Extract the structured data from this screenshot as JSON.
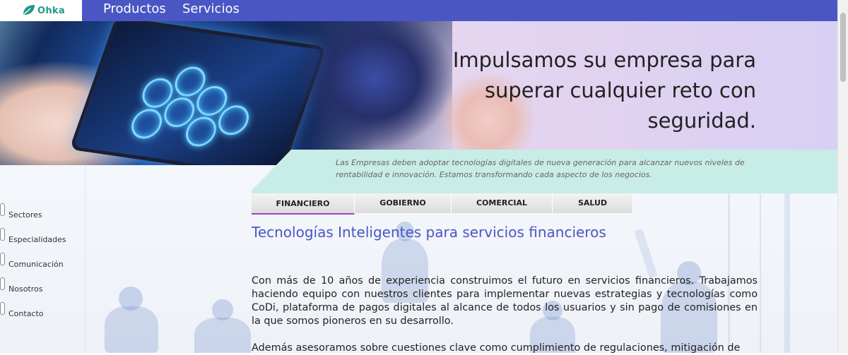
{
  "nav": {
    "logo_text": "Ohka",
    "links": [
      "Productos",
      "Servicios"
    ],
    "bg_color": "#4a56c4"
  },
  "hero": {
    "title": "Impulsamos su empresa para superar cualquier reto con seguridad.",
    "subtitle": "Las Empresas deben adoptar tecnologías digitales de nueva generación para alcanzar nuevos niveles de rentabilidad e innovación. Estamos transformando cada aspecto de los negocios."
  },
  "sidebar": {
    "items": [
      {
        "label": "Sectores"
      },
      {
        "label": "Especialidades"
      },
      {
        "label": "Comunicación"
      },
      {
        "label": "Nosotros"
      },
      {
        "label": "Contacto"
      }
    ]
  },
  "tabs": {
    "items": [
      {
        "label": "FINANCIERO",
        "active": true
      },
      {
        "label": "GOBIERNO",
        "active": false
      },
      {
        "label": "COMERCIAL",
        "active": false
      },
      {
        "label": "SALUD",
        "active": false
      }
    ],
    "active_color": "#a23ec6"
  },
  "content": {
    "title": "Tecnologías Inteligentes para servicios financieros",
    "paragraphs": [
      "Con más de 10 años de experiencia construimos el futuro en servicios financieros. Trabajamos haciendo equipo con nuestros clientes para implementar nuevas estrategias y tecnologías como CoDi, plataforma de pagos digitales al alcance de todos los usuarios y sin pago de comisiones en la que somos pioneros en su desarrollo.",
      "Además asesoramos sobre cuestiones clave como cumplimiento de regulaciones, mitigación de"
    ],
    "title_color": "#4a56c4"
  },
  "colors": {
    "band": "#c8ede6",
    "accent": "#4a56c4"
  }
}
